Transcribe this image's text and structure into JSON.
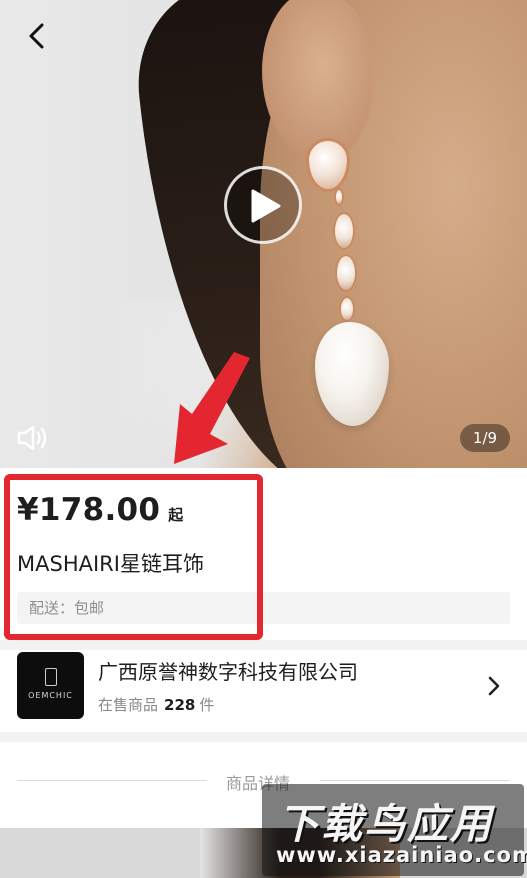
{
  "media": {
    "page_indicator": "1/9",
    "icons": {
      "back": "chevron-left-icon",
      "play": "play-icon",
      "sound": "speaker-icon"
    }
  },
  "product": {
    "price": "¥178.00",
    "price_suffix": "起",
    "title": "MASHAIRI星链耳饰",
    "shipping": "配送：包邮"
  },
  "shop": {
    "name": "广西原誉神数字科技有限公司",
    "logo_text": "OEMCHIC",
    "stats_label": "在售商品",
    "stats_count": "228",
    "stats_unit": "件"
  },
  "details": {
    "section_title": "商品详情"
  },
  "annotation": {
    "highlight_color": "#e3262f",
    "arrow_color": "#e3262f"
  },
  "watermark": {
    "brand": "下载鸟应用",
    "url": "www.xiazainiao.com"
  }
}
